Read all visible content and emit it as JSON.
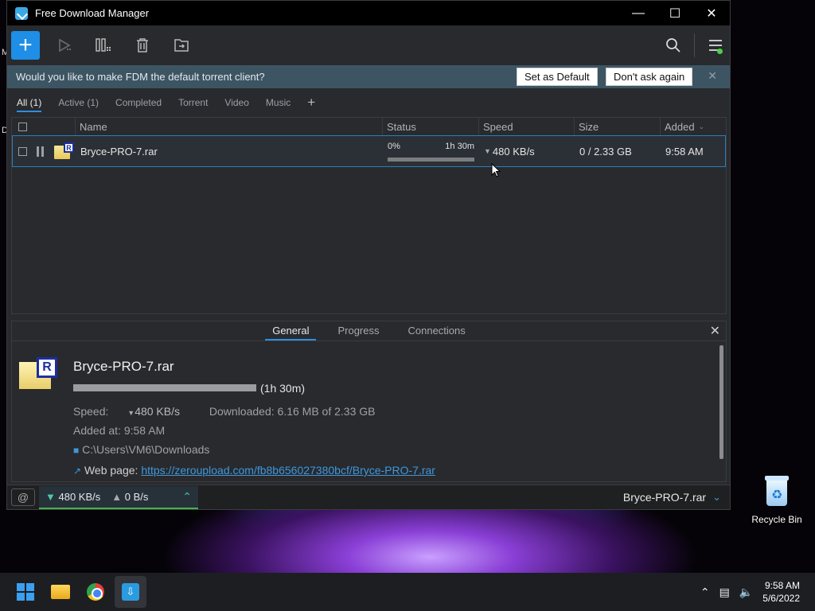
{
  "window": {
    "title": "Free Download Manager"
  },
  "banner": {
    "message": "Would you like to make FDM the default torrent client?",
    "set_default": "Set as Default",
    "dont_ask": "Don't ask again"
  },
  "filters": [
    "All (1)",
    "Active (1)",
    "Completed",
    "Torrent",
    "Video",
    "Music"
  ],
  "columns": {
    "name": "Name",
    "status": "Status",
    "speed": "Speed",
    "size": "Size",
    "added": "Added"
  },
  "download": {
    "name": "Bryce-PRO-7.rar",
    "percent": "0%",
    "progress": 0,
    "eta": "1h 30m",
    "speed": "480 KB/s",
    "size": "0 / 2.33 GB",
    "added": "9:58 AM"
  },
  "details": {
    "tabs": [
      "General",
      "Progress",
      "Connections"
    ],
    "name": "Bryce-PRO-7.rar",
    "eta": "(1h 30m)",
    "speed_label": "Speed:",
    "speed": "480 KB/s",
    "downloaded_label": "Downloaded:",
    "downloaded": "6.16 MB of 2.33 GB",
    "added_label": "Added at:",
    "added": "9:58 AM",
    "path": "C:\\Users\\VM6\\Downloads",
    "webpage_label": "Web page:",
    "webpage": "https://zeroupload.com/fb8b656027380bcf/Bryce-PRO-7.rar"
  },
  "statusbar": {
    "down": "480 KB/s",
    "up": "0 B/s",
    "file": "Bryce-PRO-7.rar"
  },
  "desktop": {
    "recycle_bin": "Recycle Bin"
  },
  "taskbar": {
    "time": "9:58 AM",
    "date": "5/6/2022"
  },
  "colors": {
    "accent": "#2d8fe0",
    "banner": "#3d5563",
    "status_green": "#44b24a"
  }
}
